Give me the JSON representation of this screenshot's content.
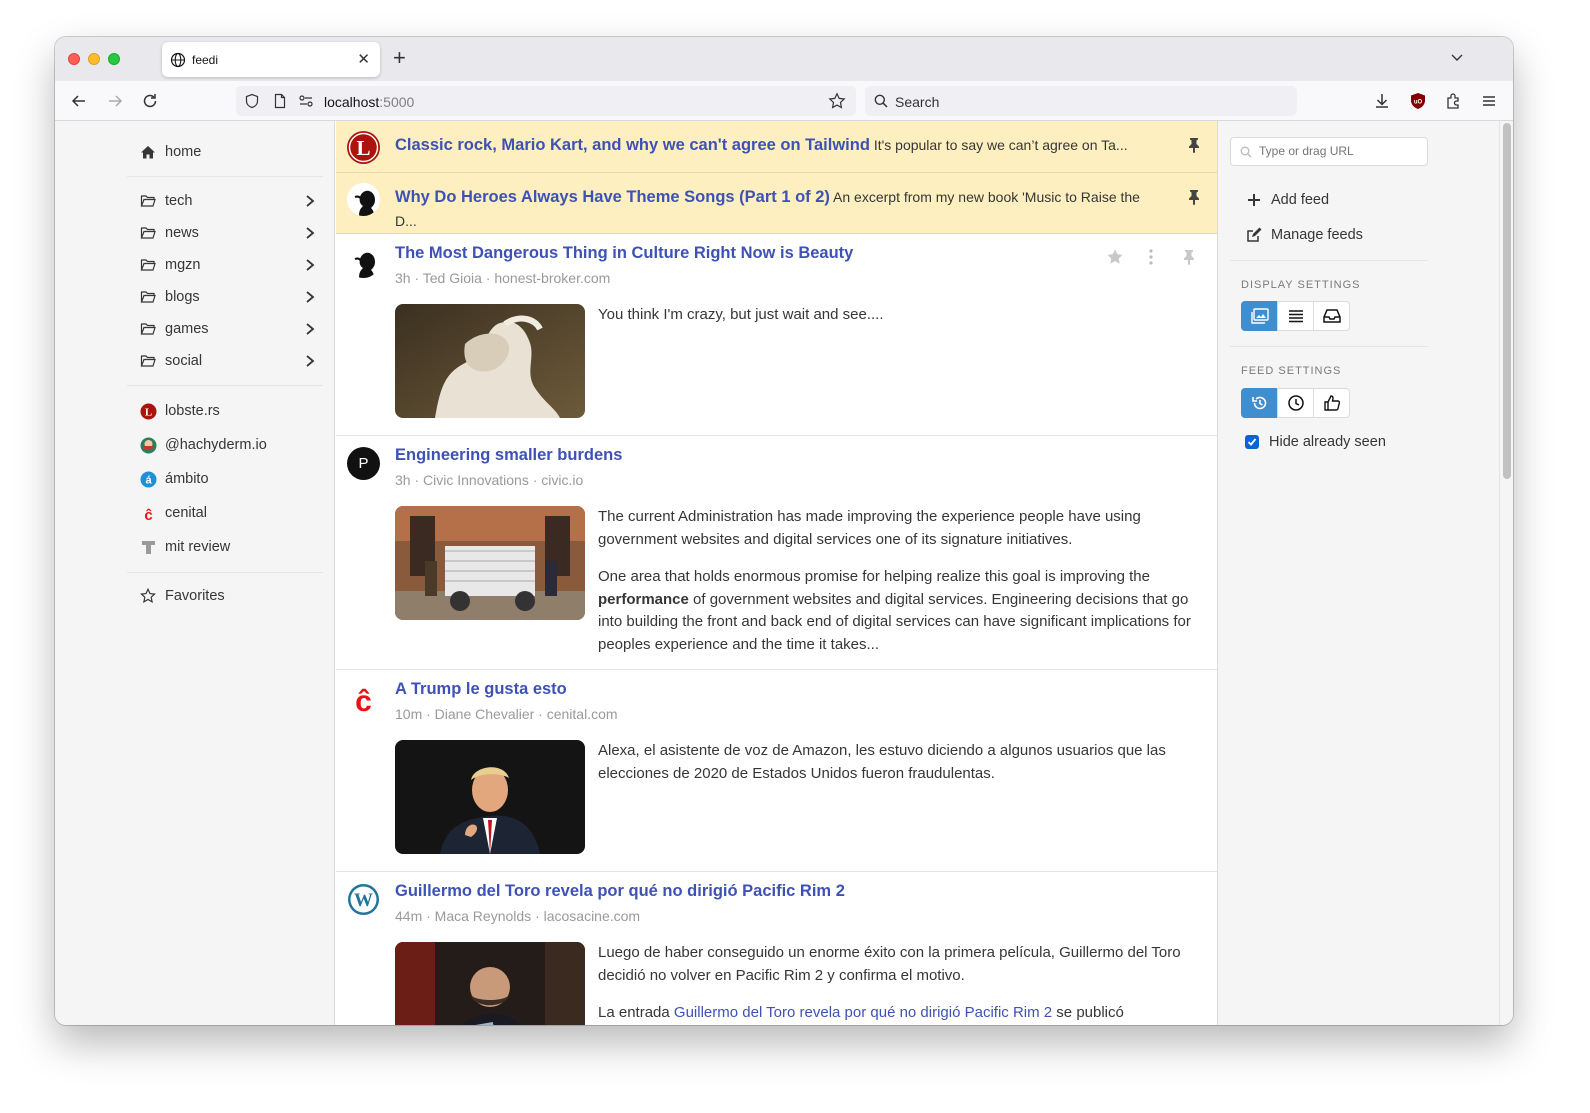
{
  "browser": {
    "tab_title": "feedi",
    "url_host": "localhost",
    "url_port": ":5000",
    "search_placeholder": "Search"
  },
  "sidebar": {
    "home": "home",
    "folders": [
      {
        "label": "tech"
      },
      {
        "label": "news"
      },
      {
        "label": "mgzn"
      },
      {
        "label": "blogs"
      },
      {
        "label": "games"
      },
      {
        "label": "social"
      }
    ],
    "feeds": [
      {
        "label": "lobste.rs",
        "icon": "lobsters-icon"
      },
      {
        "label": "@hachyderm.io",
        "icon": "hachyderm-icon"
      },
      {
        "label": "ámbito",
        "icon": "ambito-icon"
      },
      {
        "label": "cenital",
        "icon": "cenital-icon"
      },
      {
        "label": "mit review",
        "icon": "mit-review-icon"
      }
    ],
    "favorites": "Favorites"
  },
  "pinned": [
    {
      "title": "Classic rock, Mario Kart, and why we can't agree on Tailwind",
      "summary": "It's popular to say we can’t agree on Ta..."
    },
    {
      "title": "Why Do Heroes Always Have Theme Songs (Part 1 of 2)",
      "summary": "An excerpt from my new book 'Music to Raise the D..."
    }
  ],
  "entries": [
    {
      "title": "The Most Dangerous Thing in Culture Right Now is Beauty",
      "meta": "3h · Ted Gioia · honest-broker.com",
      "body": [
        "You think I'm crazy, but just wait and see...."
      ]
    },
    {
      "title": "Engineering smaller burdens",
      "meta": "3h · Civic Innovations · civic.io",
      "avatar_letter": "P",
      "body": [
        "The current Administration has made improving the experience people have using government websites and digital services one of its signature initiatives."
      ],
      "body2_pre": "One area that holds enormous promise for helping realize this goal is improving the ",
      "body2_bold": "performance",
      "body2_post": " of government websites and digital services. Engineering decisions that go into building the front and back end of digital services can have significant implications for peoples experience and the time it takes..."
    },
    {
      "title": "A Trump le gusta esto",
      "meta": "10m · Diane Chevalier · cenital.com",
      "body": [
        "Alexa, el asistente de voz de Amazon, les estuvo diciendo a algunos usuarios que las elecciones de 2020 de Estados Unidos fueron fraudulentas."
      ]
    },
    {
      "title": "Guillermo del Toro revela por qué no dirigió Pacific Rim 2",
      "meta": "44m · Maca Reynolds · lacosacine.com",
      "body": [
        "Luego de haber conseguido un enorme éxito con la primera película, Guillermo del Toro decidió no volver en Pacific Rim 2 y confirma el motivo."
      ],
      "body2_pre": "La entrada ",
      "body2_link": "Guillermo del Toro revela por qué no dirigió Pacific Rim 2",
      "body2_post": " se publicó"
    }
  ],
  "right": {
    "url_placeholder": "Type or drag URL",
    "add_feed": "Add feed",
    "manage_feeds": "Manage feeds",
    "display_settings": "DISPLAY SETTINGS",
    "feed_settings": "FEED SETTINGS",
    "hide_seen": "Hide already seen"
  },
  "colors": {
    "accent": "#3e52b5",
    "pinned_bg": "#fdefbf",
    "active_button": "#3e8ed0"
  }
}
